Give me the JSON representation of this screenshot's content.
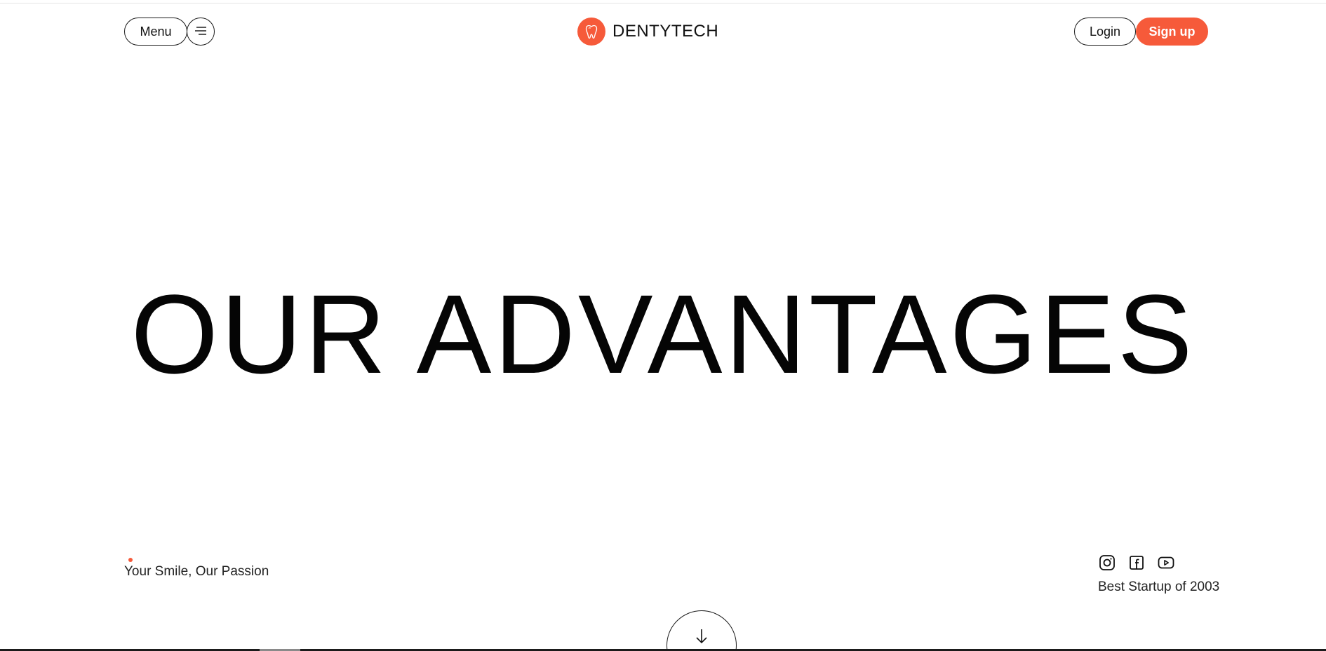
{
  "header": {
    "menu_label": "Menu",
    "menu_icon": "hamburger-lines-icon",
    "logo_icon": "tooth-icon",
    "logo_text": "DENTYTECH",
    "login_label": "Login",
    "signup_label": "Sign up"
  },
  "hero": {
    "title": "OUR ADVANTAGES"
  },
  "footer": {
    "tagline": "Your Smile, Our Passion",
    "socials": [
      "instagram-icon",
      "facebook-icon",
      "youtube-icon"
    ],
    "award": "Best Startup of 2003",
    "scroll_icon": "arrow-down-icon"
  },
  "colors": {
    "accent": "#f65a3a",
    "text": "#111111",
    "background": "#ffffff"
  }
}
